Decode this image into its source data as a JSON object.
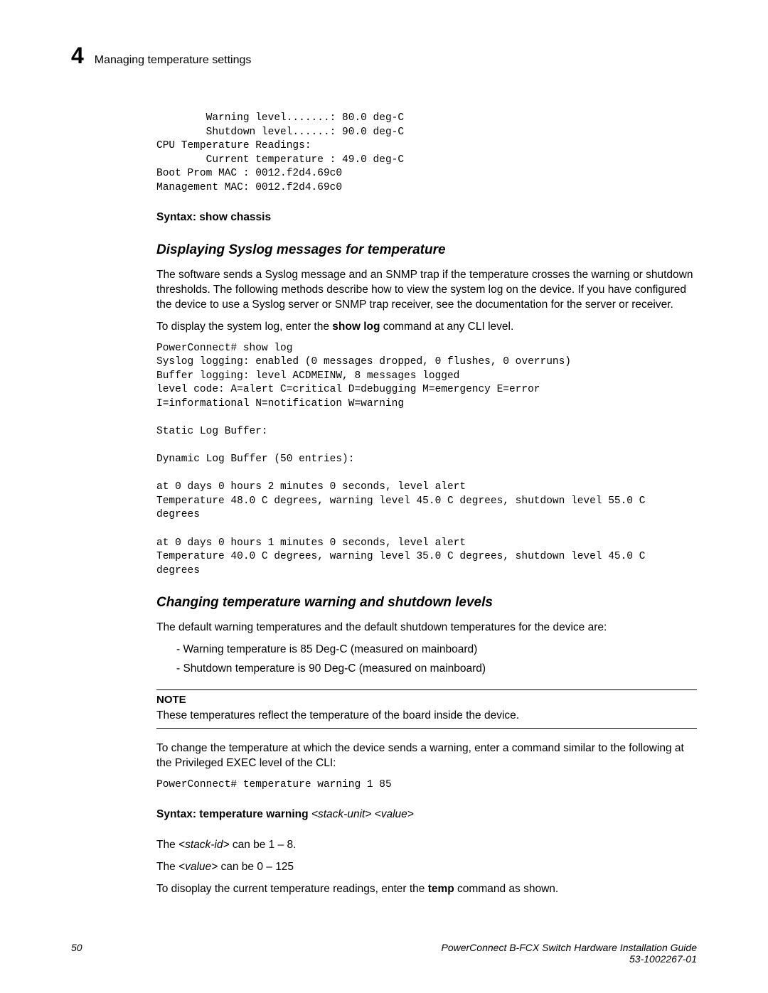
{
  "header": {
    "chapter_num": "4",
    "title": "Managing temperature settings"
  },
  "code_block_1": "        Warning level.......: 80.0 deg-C\n        Shutdown level......: 90.0 deg-C\nCPU Temperature Readings:\n        Current temperature : 49.0 deg-C\nBoot Prom MAC : 0012.f2d4.69c0\nManagement MAC: 0012.f2d4.69c0",
  "syntax1_label": "Syntax:",
  "syntax1_cmd": " show chassis",
  "section1": {
    "heading": "Displaying Syslog messages for temperature",
    "p1": "The software sends a Syslog message and an SNMP trap if the temperature crosses the warning or shutdown thresholds. The following methods describe how to view the system log on the device. If you have configured the device to use a Syslog server or SNMP trap receiver, see the documentation for the server or receiver.",
    "p2a": "To display the system log, enter the ",
    "p2b": "show log",
    "p2c": " command at any CLI level.",
    "code": "PowerConnect# show log\nSyslog logging: enabled (0 messages dropped, 0 flushes, 0 overruns)\nBuffer logging: level ACDMEINW, 8 messages logged\nlevel code: A=alert C=critical D=debugging M=emergency E=error\nI=informational N=notification W=warning\n\nStatic Log Buffer:\n\nDynamic Log Buffer (50 entries):\n\nat 0 days 0 hours 2 minutes 0 seconds, level alert\nTemperature 48.0 C degrees, warning level 45.0 C degrees, shutdown level 55.0 C \ndegrees\n\nat 0 days 0 hours 1 minutes 0 seconds, level alert\nTemperature 40.0 C degrees, warning level 35.0 C degrees, shutdown level 45.0 C \ndegrees"
  },
  "section2": {
    "heading": "Changing temperature warning and shutdown levels",
    "p1": "The default warning temperatures and the default shutdown temperatures for the device are:",
    "bullet1": "- Warning temperature is 85 Deg-C (measured on mainboard)",
    "bullet2": "- Shutdown temperature is 90 Deg-C (measured on mainboard)",
    "note_h": "NOTE",
    "note_body": "These temperatures reflect the temperature of the board inside the device.",
    "p2": "To change the temperature at which the device sends a warning, enter a command similar to the following at the Privileged EXEC level of the CLI:",
    "code": "PowerConnect# temperature warning 1 85",
    "syntax_label": "Syntax:",
    "syntax_cmd": " temperature warning ",
    "syntax_args": "<stack-unit> <value>",
    "p3a": "The ",
    "p3b": "<stack-id>",
    "p3c": " can be 1 – 8.",
    "p4a": "The ",
    "p4b": "<value>",
    "p4c": " can be 0 – 125",
    "p5a": "To disoplay the current temperature readings, enter the ",
    "p5b": "temp",
    "p5c": " command as shown."
  },
  "footer": {
    "page": "50",
    "title": "PowerConnect B-FCX Switch Hardware Installation Guide",
    "docnum": "53-1002267-01"
  }
}
